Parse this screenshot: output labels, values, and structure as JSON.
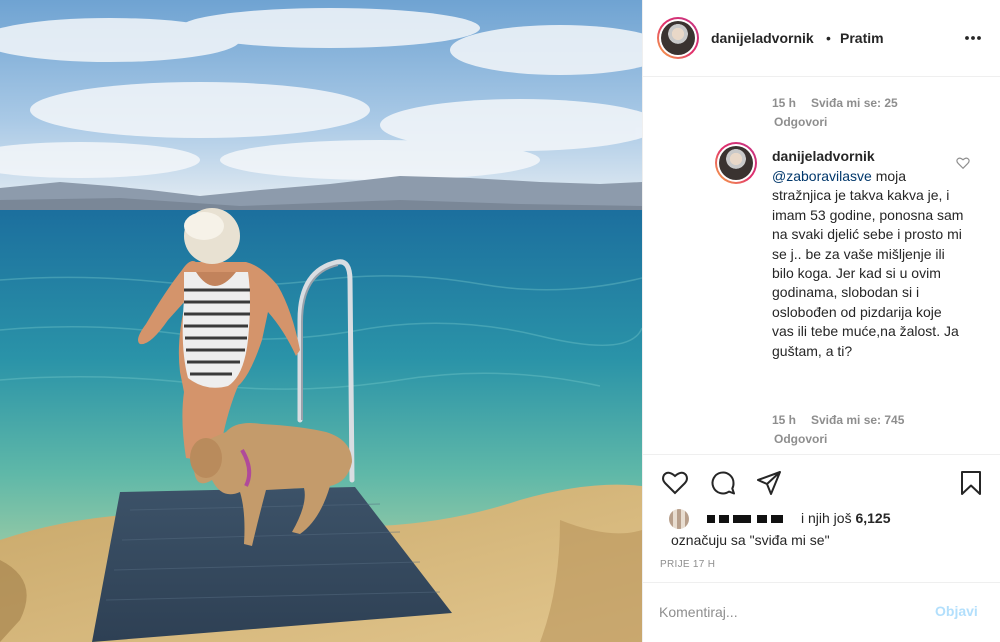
{
  "post": {
    "image_alt": "",
    "author": "danijeladvornik",
    "separator": "•",
    "follow_label": "Pratim",
    "more_icon": "more-horizontal-icon"
  },
  "comments": {
    "previous": {
      "time": "15 h",
      "likes_label": "Sviđa mi se: 25",
      "reply_label": "Odgovori"
    },
    "reply": {
      "username": "danijeladvornik",
      "mention": "@zaboravilasve",
      "text": " moja stražnjica je takva kakva je, i imam 53 godine, ponosna sam na svaki djelić sebe i prosto mi se j.. be za vaše mišljenje ili bilo koga. Jer kad si u ovim godinama, slobodan si i oslobođen od pizdarija koje vas ili tebe muće,na žalost. Ja guštam, a ti?",
      "time": "15 h",
      "likes_label": "Sviđa mi se: 745",
      "reply_label": "Odgovori",
      "like_icon": "heart-outline-icon"
    }
  },
  "actions": {
    "icons": [
      "heart-icon",
      "comment-icon",
      "share-icon",
      "bookmark-icon"
    ],
    "likes_prefix": "i njih još ",
    "likes_count": "6,125",
    "likes_suffix": "označuju sa \"sviđa mi se\"",
    "time_ago": "PRIJE 17 H"
  },
  "add_comment": {
    "placeholder": "Komentiraj...",
    "post_label": "Objavi"
  },
  "colors": {
    "link_blue": "#00376b",
    "post_button_disabled": "#b2dffc",
    "secondary_text": "#8e8e8e",
    "border": "#efefef"
  }
}
